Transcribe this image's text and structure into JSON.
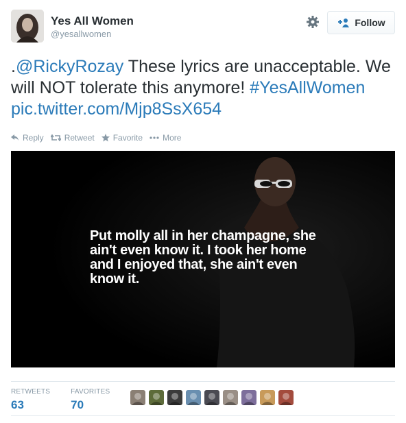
{
  "user": {
    "name": "Yes All Women",
    "handle": "@yesallwomen"
  },
  "follow_label": "Follow",
  "tweet": {
    "prefix": ".",
    "mention": "@RickyRozay",
    "body": " These lyrics are unacceptable. We will NOT tolerate this anymore! ",
    "hashtag": "#YesAllWomen",
    "space": " ",
    "link": "pic.twitter.com/Mjp8SsX654"
  },
  "actions": {
    "reply": "Reply",
    "retweet": "Retweet",
    "favorite": "Favorite",
    "more": "More"
  },
  "media": {
    "caption": "Put molly all in her champagne, she ain't even know it. I took her home and I enjoyed that, she ain't even know it."
  },
  "stats": {
    "retweets_label": "RETWEETS",
    "retweets_value": "63",
    "favorites_label": "FAVORITES",
    "favorites_value": "70"
  },
  "favoriter_colors": [
    "#8a7f74",
    "#5d6b3a",
    "#3b3b3b",
    "#6a8fb0",
    "#4a4a52",
    "#9a8f86",
    "#7d6e9b",
    "#c89a5a",
    "#a34b3d"
  ],
  "icons": [
    "gear-icon",
    "add-user-icon",
    "reply-icon",
    "retweet-icon",
    "favorite-icon",
    "more-icon"
  ],
  "colors": {
    "link": "#2b7bb9",
    "muted": "#8899a6",
    "text": "#292f33"
  }
}
